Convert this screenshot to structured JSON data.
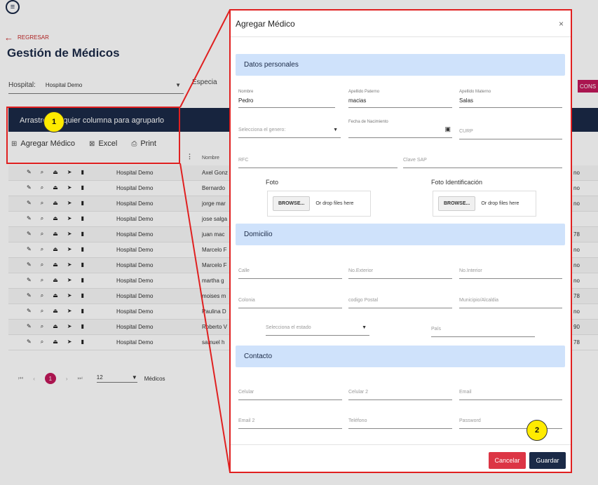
{
  "app": {
    "menu_icon": "hamburger-icon",
    "back_label": "REGRESAR",
    "page_title": "Gestión de Médicos"
  },
  "filters": {
    "hospital_label": "Hospital:",
    "hospital_value": "Hospital Demo",
    "especialidad_label": "Especia",
    "consultar_label": "CONS"
  },
  "grid": {
    "group_hint": "Arrastre cualquier columna para agruparlo",
    "toolbar": {
      "add_label": "Agregar Médico",
      "excel_label": "Excel",
      "print_label": "Print"
    },
    "nombre_header": "Nombre",
    "rows": [
      {
        "hospital": "Hospital Demo",
        "nombre": "Axel Gonz",
        "extra": "no"
      },
      {
        "hospital": "Hospital Demo",
        "nombre": "Bernardo",
        "extra": "no"
      },
      {
        "hospital": "Hospital Demo",
        "nombre": "jorge mar",
        "extra": "no"
      },
      {
        "hospital": "Hospital Demo",
        "nombre": "jose salga",
        "extra": ""
      },
      {
        "hospital": "Hospital Demo",
        "nombre": "juan mac",
        "extra": "78"
      },
      {
        "hospital": "Hospital Demo",
        "nombre": "Marcelo F",
        "extra": "no"
      },
      {
        "hospital": "Hospital Demo",
        "nombre": "Marcelo F",
        "extra": "no"
      },
      {
        "hospital": "Hospital Demo",
        "nombre": "martha g",
        "extra": "no"
      },
      {
        "hospital": "Hospital Demo",
        "nombre": "moises m",
        "extra": "78"
      },
      {
        "hospital": "Hospital Demo",
        "nombre": "Paulina D",
        "extra": "no"
      },
      {
        "hospital": "Hospital Demo",
        "nombre": "Roberto V",
        "extra": "90"
      },
      {
        "hospital": "Hospital Demo",
        "nombre": "samuel h",
        "extra": "78"
      }
    ],
    "pager": {
      "first": "⏮",
      "prev": "‹",
      "current_page": "1",
      "next": "›",
      "last": "⏭",
      "page_size": "12",
      "items_label": "Médicos"
    }
  },
  "modal": {
    "title": "Agregar Médico",
    "close": "×",
    "sections": {
      "personal": "Datos personales",
      "domicilio": "Domicilio",
      "contacto": "Contacto"
    },
    "personal": {
      "nombre_label": "Nombre",
      "nombre_value": "Pedro",
      "apellido_paterno_label": "Apellido Paterno",
      "apellido_paterno_value": "macias",
      "apellido_materno_label": "Apellido Materno",
      "apellido_materno_value": "Salas",
      "genero_placeholder": "Selecciona el genero:",
      "fecha_label": "Fecha de Nacimiento",
      "curp_placeholder": "CURP",
      "rfc_placeholder": "RFC",
      "clave_sap_placeholder": "Clave SAP",
      "foto_label": "Foto",
      "foto_id_label": "Foto Identificación",
      "browse_label": "BROWSE...",
      "drop_label": "Or drop files here"
    },
    "domicilio": {
      "calle": "Calle",
      "no_exterior": "No.Exterior",
      "no_interior": "No.Interior",
      "colonia": "Colonia",
      "codigo_postal": "codigo Postal",
      "municipio": "Municipio/Alcaldia",
      "estado_placeholder": "Selecciona el estado",
      "pais": "País"
    },
    "contacto": {
      "celular": "Celular",
      "celular2": "Celular 2",
      "email": "Email",
      "email2": "Email 2",
      "telefono": "Teléfono",
      "password": "Password"
    },
    "cancel_label": "Cancelar",
    "save_label": "Guardar"
  },
  "annotations": {
    "badge1": "1",
    "badge2": "2",
    "highlight_color": "#e02020",
    "badge_color": "#ffeb00"
  }
}
